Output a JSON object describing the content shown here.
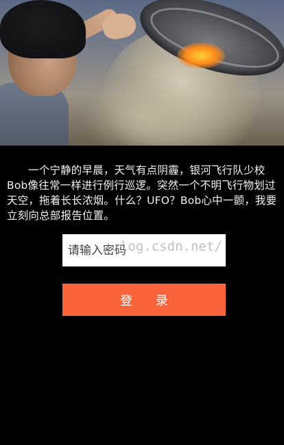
{
  "story": {
    "text": "一个宁静的早晨，天气有点阴霾，银河飞行队少校Bob像往常一样进行例行巡逻。突然一个不明飞行物划过天空，拖着长长浓烟。什么？UFO？Bob心中一颤，我要立刻向总部报告位置。"
  },
  "login_form": {
    "password_placeholder": "请输入密码",
    "password_value": "",
    "login_label": "登 录"
  },
  "watermark": {
    "text": "log.csdn.net/"
  },
  "colors": {
    "background": "#000000",
    "login_button": "#f9643d",
    "input_background": "#ffffff",
    "story_text": "#f2f2f2"
  }
}
